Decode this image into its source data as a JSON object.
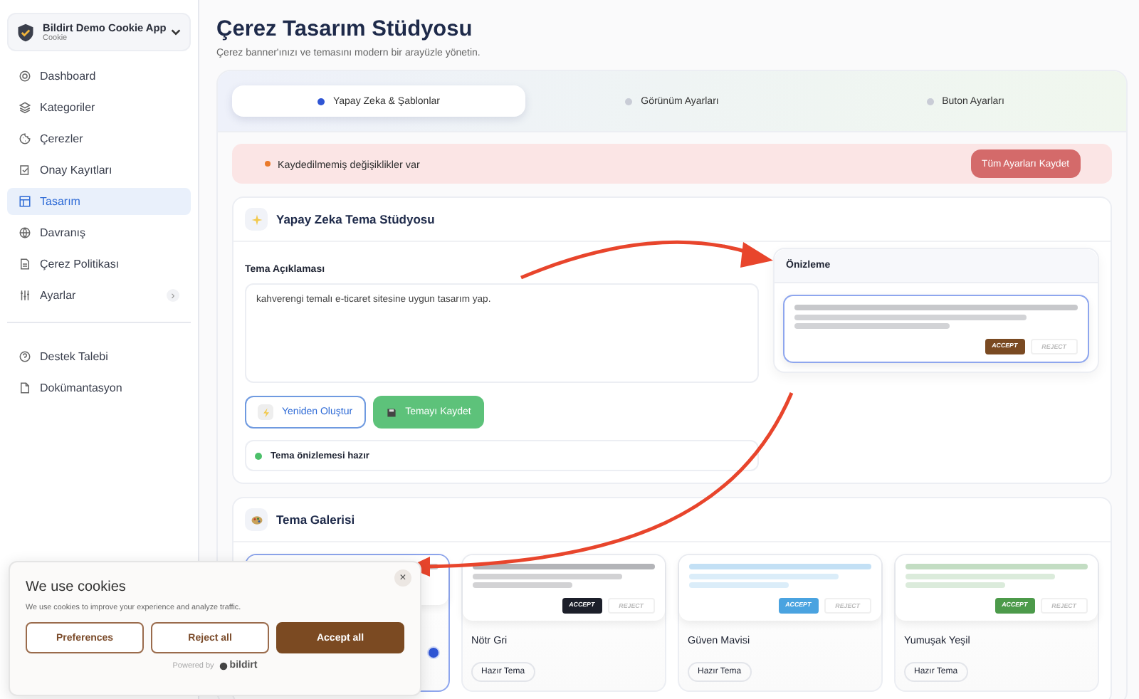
{
  "app": {
    "name": "Bildirt Demo Cookie App",
    "subtitle": "Cookie"
  },
  "nav": [
    {
      "label": "Dashboard",
      "selected": false
    },
    {
      "label": "Kategoriler",
      "selected": false
    },
    {
      "label": "Çerezler",
      "selected": false
    },
    {
      "label": "Onay Kayıtları",
      "selected": false
    },
    {
      "label": "Tasarım",
      "selected": true
    },
    {
      "label": "Davranış",
      "selected": false
    },
    {
      "label": "Çerez Politikası",
      "selected": false
    },
    {
      "label": "Ayarlar",
      "selected": false,
      "chevron": "›"
    }
  ],
  "nav_bottom": [
    {
      "label": "Destek Talebi"
    },
    {
      "label": "Dokümantasyon"
    }
  ],
  "title": "Çerez Tasarım Stüdyosu",
  "subtitle": "Çerez banner'ınızı ve temasını modern bir arayüzle yönetin.",
  "tabs": [
    {
      "label": "Yapay Zeka & Şablonlar",
      "selected": true
    },
    {
      "label": "Görünüm Ayarları",
      "selected": false
    },
    {
      "label": "Buton Ayarları",
      "selected": false
    }
  ],
  "unsaved": {
    "text": "Kaydedilmemiş değişiklikler var",
    "button": "Tüm Ayarları Kaydet"
  },
  "studio": {
    "title": "Yapay Zeka Tema Stüdyosu",
    "label": "Tema Açıklaması",
    "value": "kahverengi temalı e-ticaret sitesine uygun tasarım yap.",
    "regenerate": "Yeniden Oluştur",
    "save": "Temayı Kaydet",
    "status": "Tema önizlemesi hazır",
    "preview_title": "Önizleme",
    "preview": {
      "accept": "ACCEPT",
      "reject": "REJECT",
      "color": "#7a4a22"
    }
  },
  "gallery": {
    "title": "Tema Galerisi",
    "themes": [
      {
        "selected": true
      },
      {
        "selected": false,
        "name": "Nötr Gri",
        "tag": "Hazır Tema",
        "accept": "ACCEPT",
        "reject": "REJECT",
        "color": "#1c1f2a"
      },
      {
        "selected": false,
        "name": "Güven Mavisi",
        "tag": "Hazır Tema",
        "accept": "ACCEPT",
        "reject": "REJECT",
        "color": "#4aa3e0"
      },
      {
        "selected": false,
        "name": "Yumuşak Yeşil",
        "tag": "Hazır Tema",
        "accept": "ACCEPT",
        "reject": "REJECT",
        "color": "#4c9a4a"
      }
    ]
  },
  "cookie_banner": {
    "title": "We use cookies",
    "text": "We use cookies to improve your experience and analyze traffic.",
    "close": "×",
    "buttons": [
      {
        "label": "Preferences",
        "kind": "outline"
      },
      {
        "label": "Reject all",
        "kind": "outline"
      },
      {
        "label": "Accept all",
        "kind": "filled"
      }
    ],
    "powered": "Powered by",
    "brand": "bildirt"
  }
}
